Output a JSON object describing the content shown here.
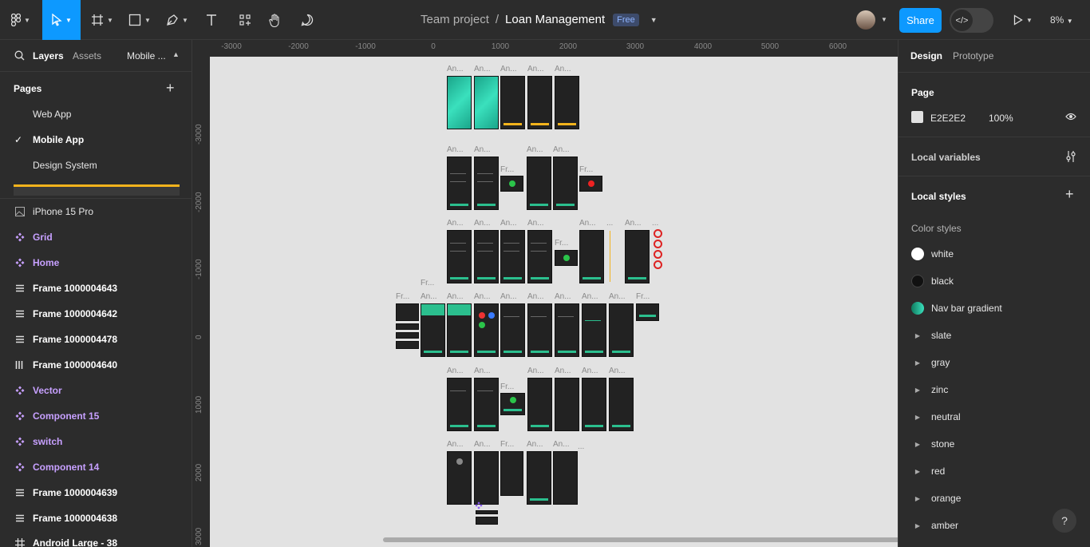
{
  "toolbar": {
    "team": "Team project",
    "separator": "/",
    "file": "Loan Management",
    "plan_badge": "Free",
    "share_label": "Share",
    "dev_mode_glyph": "</>",
    "zoom": "8%"
  },
  "left_panel": {
    "tabs": {
      "layers": "Layers",
      "assets": "Assets",
      "page_switch": "Mobile ..."
    },
    "pages_heading": "Pages",
    "pages": [
      {
        "label": "Web App",
        "selected": false
      },
      {
        "label": "Mobile App",
        "selected": true
      },
      {
        "label": "Design System",
        "selected": false
      }
    ],
    "layers": [
      {
        "label": "iPhone 15 Pro",
        "kind": "image"
      },
      {
        "label": "Grid",
        "kind": "component"
      },
      {
        "label": "Home",
        "kind": "component"
      },
      {
        "label": "Frame 1000004643",
        "kind": "frame-vertical"
      },
      {
        "label": "Frame 1000004642",
        "kind": "frame-vertical"
      },
      {
        "label": "Frame 1000004478",
        "kind": "frame-vertical"
      },
      {
        "label": "Frame 1000004640",
        "kind": "frame-horizontal"
      },
      {
        "label": "Vector",
        "kind": "component"
      },
      {
        "label": "Component 15",
        "kind": "component"
      },
      {
        "label": "switch",
        "kind": "component"
      },
      {
        "label": "Component 14",
        "kind": "component"
      },
      {
        "label": "Frame 1000004639",
        "kind": "frame-vertical"
      },
      {
        "label": "Frame 1000004638",
        "kind": "frame-vertical"
      },
      {
        "label": "Android Large - 38",
        "kind": "frame-grid"
      }
    ]
  },
  "canvas": {
    "background": "#e2e2e2",
    "ruler_x": [
      "-3000",
      "-2000",
      "-1000",
      "0",
      "1000",
      "2000",
      "3000",
      "4000",
      "5000",
      "6000"
    ],
    "ruler_y": [
      "-3000",
      "-2000",
      "-1000",
      "0",
      "1000",
      "2000",
      "3000"
    ],
    "frame_label_short": "An...",
    "frame_label_fr": "Fr...",
    "frame_label_dots": "..."
  },
  "right_panel": {
    "tabs": {
      "design": "Design",
      "prototype": "Prototype"
    },
    "page_heading": "Page",
    "page_color": "E2E2E2",
    "page_opacity": "100%",
    "local_variables": "Local variables",
    "local_styles": "Local styles",
    "color_styles_heading": "Color styles",
    "color_styles": [
      {
        "label": "white",
        "type": "swatch",
        "color": "#ffffff"
      },
      {
        "label": "black",
        "type": "swatch",
        "color": "#111111"
      },
      {
        "label": "Nav bar gradient",
        "type": "gradient",
        "color": "#1aa58a"
      },
      {
        "label": "slate",
        "type": "group"
      },
      {
        "label": "gray",
        "type": "group"
      },
      {
        "label": "zinc",
        "type": "group"
      },
      {
        "label": "neutral",
        "type": "group"
      },
      {
        "label": "stone",
        "type": "group"
      },
      {
        "label": "red",
        "type": "group"
      },
      {
        "label": "orange",
        "type": "group"
      },
      {
        "label": "amber",
        "type": "group"
      }
    ],
    "help": "?"
  },
  "colors": {
    "accent": "#0d99ff",
    "component": "#c7a0ff",
    "warning": "#f3b31c"
  }
}
